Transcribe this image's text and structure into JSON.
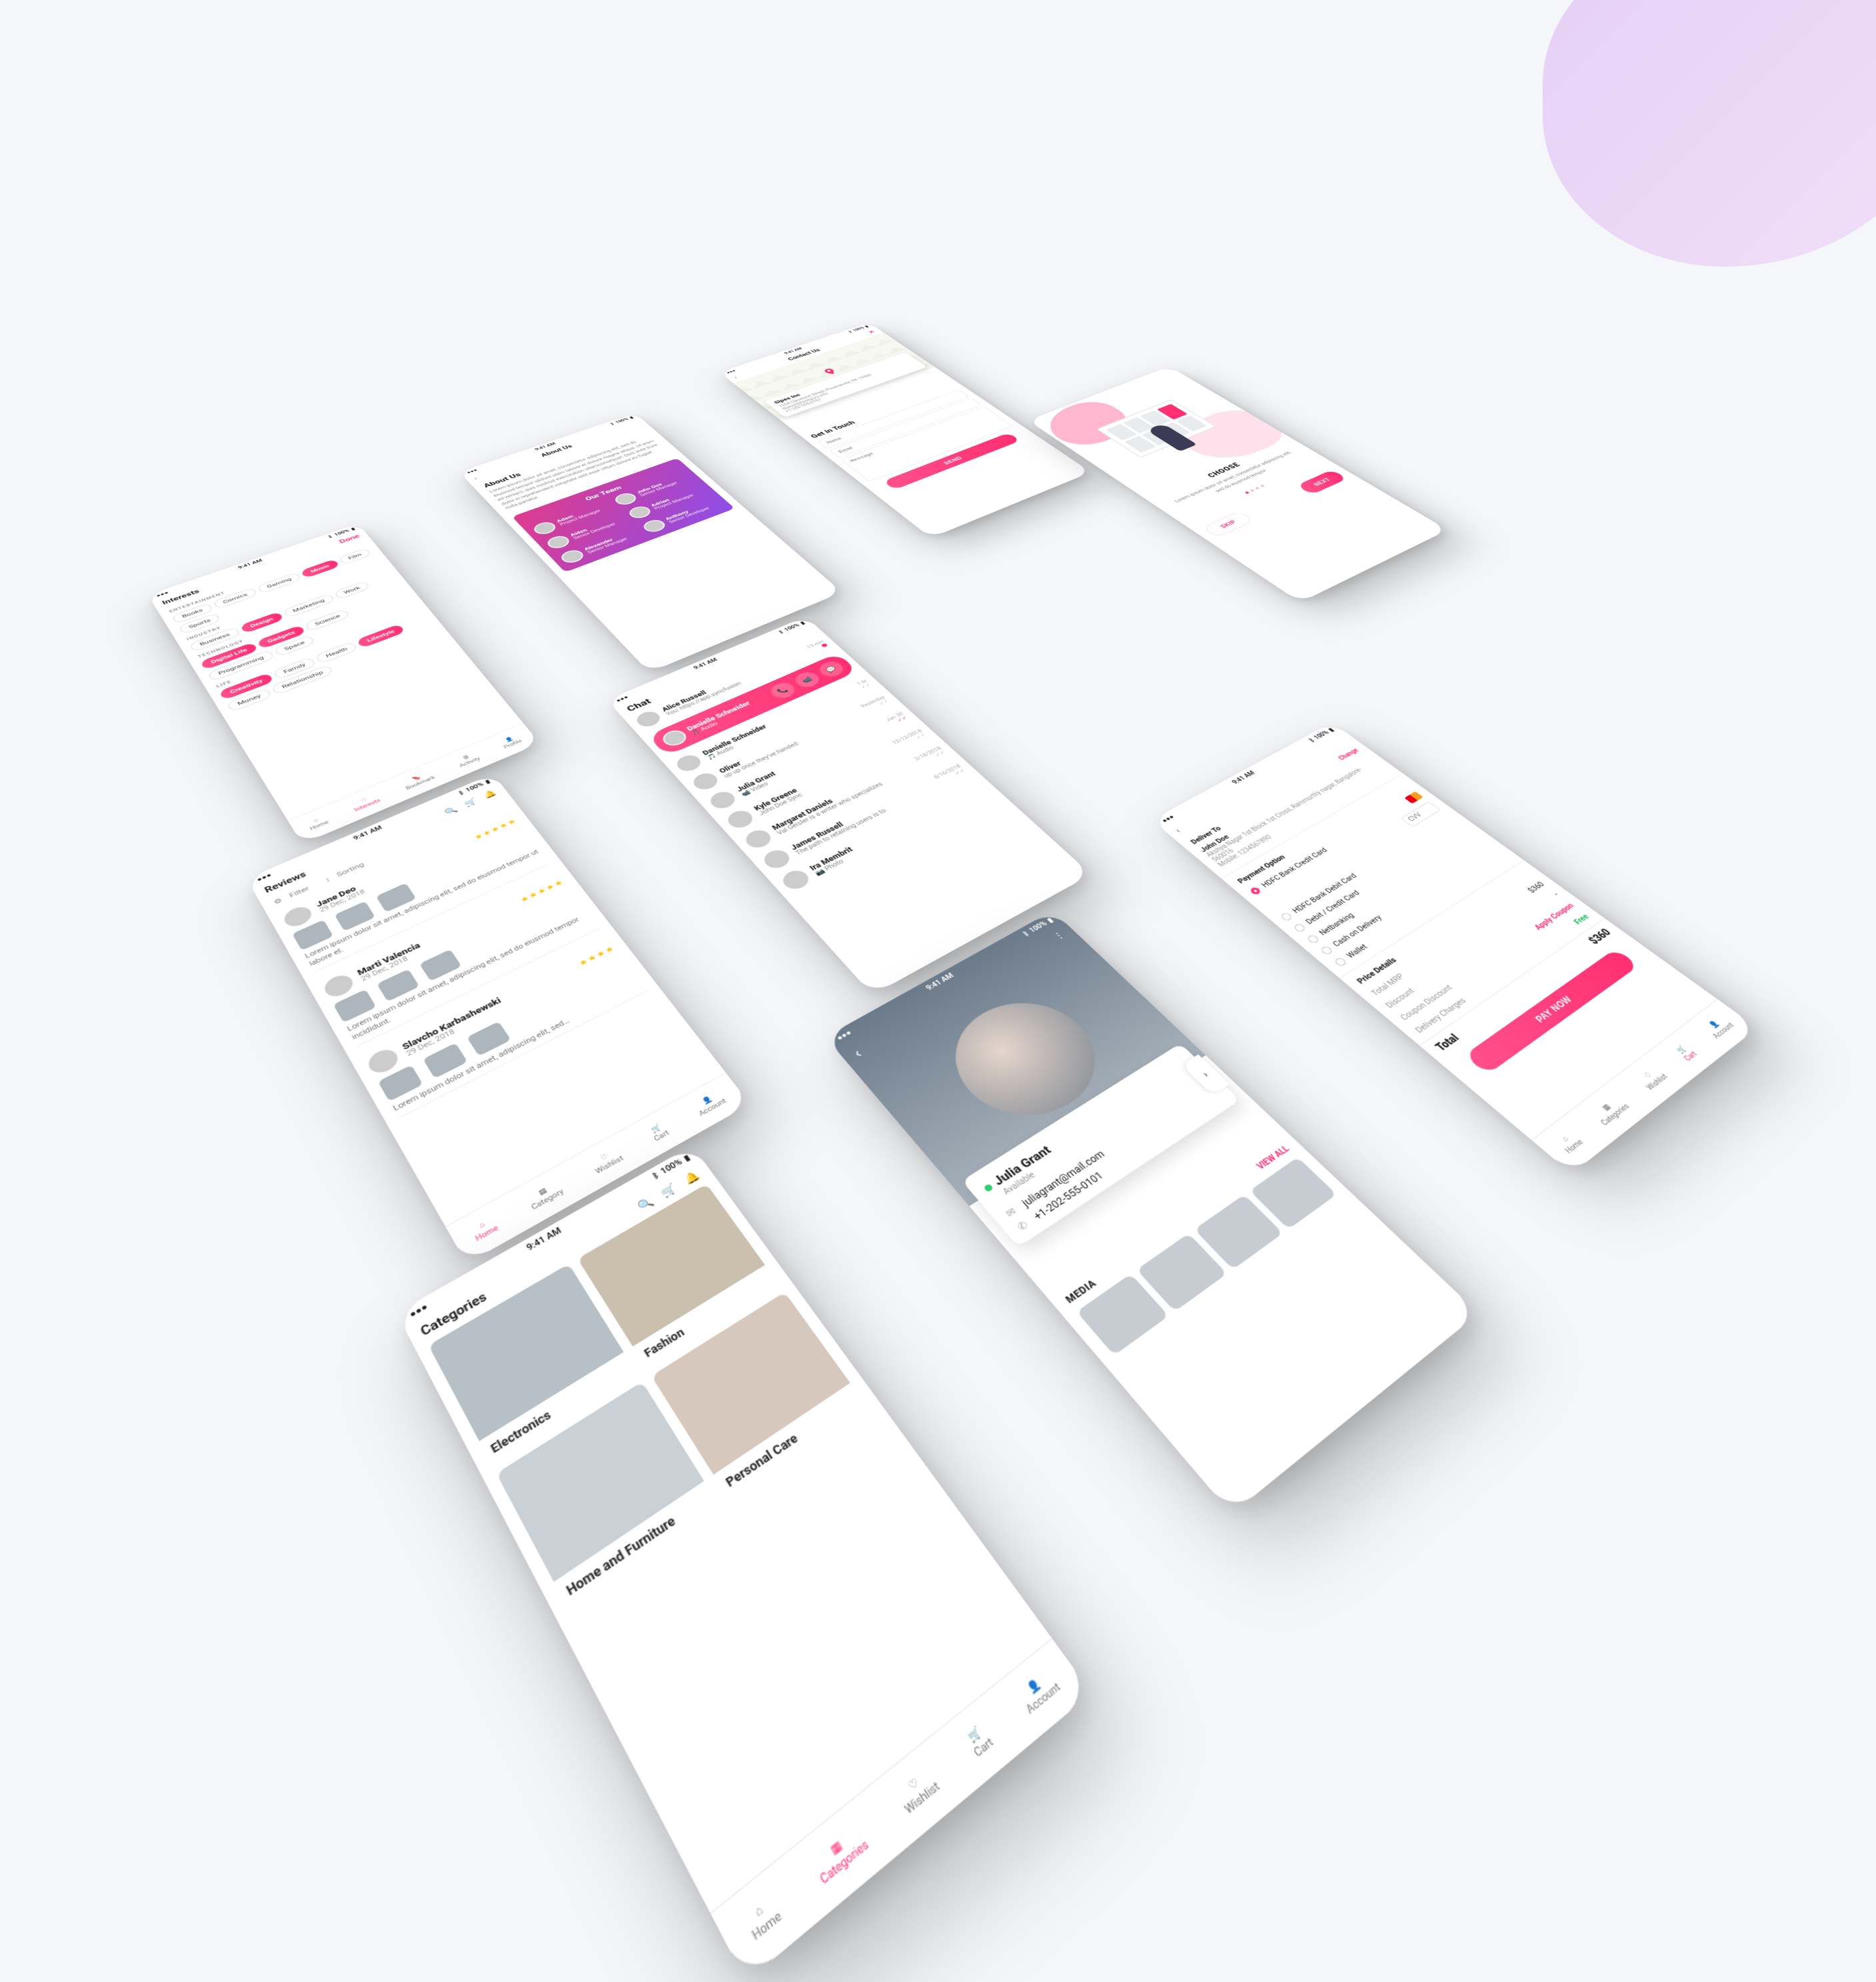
{
  "status": {
    "time": "9:41 AM",
    "battery": "100%"
  },
  "interests": {
    "title": "Interests",
    "action": "Done",
    "groups": [
      {
        "label": "ENTERTAINMENT",
        "chips": [
          {
            "t": "Books",
            "sel": false
          },
          {
            "t": "Comics",
            "sel": false
          },
          {
            "t": "Gaming",
            "sel": false
          },
          {
            "t": "Music",
            "sel": true
          },
          {
            "t": "Film",
            "sel": false
          },
          {
            "t": "Sports",
            "sel": false
          }
        ]
      },
      {
        "label": "INDUSTRY",
        "chips": [
          {
            "t": "Business",
            "sel": false
          },
          {
            "t": "Design",
            "sel": true
          },
          {
            "t": "Marketing",
            "sel": false
          },
          {
            "t": "Work",
            "sel": false
          }
        ]
      },
      {
        "label": "TECHNOLOGY",
        "chips": [
          {
            "t": "Digital Life",
            "sel": true
          },
          {
            "t": "Gadgets",
            "sel": true
          },
          {
            "t": "Science",
            "sel": false
          },
          {
            "t": "Programming",
            "sel": false
          },
          {
            "t": "Space",
            "sel": false
          }
        ]
      },
      {
        "label": "LIFE",
        "chips": [
          {
            "t": "Creativity",
            "sel": true
          },
          {
            "t": "Family",
            "sel": false
          },
          {
            "t": "Health",
            "sel": false
          },
          {
            "t": "Lifestyle",
            "sel": true
          },
          {
            "t": "Money",
            "sel": false
          },
          {
            "t": "Relationship",
            "sel": false
          }
        ]
      }
    ],
    "nav": [
      {
        "label": "Home",
        "active": false
      },
      {
        "label": "Interests",
        "active": true
      },
      {
        "label": "Bookmark",
        "active": false
      },
      {
        "label": "Activity",
        "active": false
      },
      {
        "label": "Profile",
        "active": false
      }
    ]
  },
  "about": {
    "title": "About Us",
    "heading": "About Us",
    "body": "Lorem ipsum dolor sit amet, consectetur adipiscing elit, sed do eiusmod tempor ididunt utem labore et dolore magna aliqua. Ut enim ad veniam, quis nostrud exercitation ullamconsequat. Duis aute irure dolor in reprehenderit voluptate velit esse cillum dolore eu fugiat nulla pariatur.",
    "team_title": "Our Team",
    "team": [
      {
        "name": "Adam",
        "role": "Project Manager"
      },
      {
        "name": "John Doe",
        "role": "Senior Manager"
      },
      {
        "name": "Aiden",
        "role": "Senior Developer"
      },
      {
        "name": "Adrian",
        "role": "Project Manager"
      },
      {
        "name": "Alexander",
        "role": "Senior Manager"
      },
      {
        "name": "Anthony",
        "role": "Senior Developer"
      }
    ]
  },
  "contact": {
    "title": "Contact Us",
    "card": {
      "company": "Sipes Inc",
      "address": "7654 Cleveland Street, Phoenixville, PA 19460",
      "email": "dopuyi@hostguru.info",
      "phone": "+1-202-555-0101"
    },
    "heading": "Get in Touch",
    "fields": {
      "name": "Name",
      "email": "Email",
      "message": "Message"
    },
    "submit": "SEND"
  },
  "reviews": {
    "title": "Reviews",
    "filter": "Filter",
    "sorting": "Sorting",
    "items": [
      {
        "name": "Jane Deo",
        "date": "29 Dec, 2018",
        "rating": 5,
        "text": "Lorem ipsum dolor sit amet, adipiscing elit, sed do eiusmod tempor ut labore et."
      },
      {
        "name": "Marti Valencia",
        "date": "29 Dec, 2018",
        "rating": 5,
        "text": "Lorem ipsum dolor sit amet, adipiscing elit, sed do eiusmod tempor incididunt."
      },
      {
        "name": "Slavcho Karbashewski",
        "date": "29 Dec, 2018",
        "rating": 4,
        "text": "Lorem ipsum dolor sit amet, adipiscing elit, sed…"
      }
    ],
    "nav": [
      {
        "label": "Home",
        "active": true
      },
      {
        "label": "Category",
        "active": false
      },
      {
        "label": "Wishlist",
        "active": false
      },
      {
        "label": "Cart",
        "active": false
      },
      {
        "label": "Account",
        "active": false
      }
    ]
  },
  "chat": {
    "title": "Chat",
    "threads": [
      {
        "name": "Alice Russell",
        "sub": "You: https://app.syncfusion",
        "time": "15 min",
        "status": "unread"
      },
      {
        "name": "Danielle Schneider",
        "sub": "🎵 Audio",
        "time": "1 hr",
        "status": "sent"
      },
      {
        "name": "Oliver",
        "sub": "up up once they've handed",
        "time": "Yesterday",
        "status": "read"
      },
      {
        "name": "Julia Grant",
        "sub": "📹 Video",
        "time": "Jan 30",
        "status": "sent-accent"
      },
      {
        "name": "Kyle Greene",
        "sub": "John Doe Sync",
        "time": "12/12/2018",
        "status": "read"
      },
      {
        "name": "Margaret Daniels",
        "sub": "Val Geisler is a writer who specializes",
        "time": "3/18/2018",
        "status": "read"
      },
      {
        "name": "James Russell",
        "sub": "The path to retaining users is to",
        "time": "8/16/2018",
        "status": "read"
      },
      {
        "name": "Ira Membrit",
        "sub": "📷 Photo",
        "time": "",
        "status": ""
      }
    ],
    "call": {
      "title": "Danielle Schneider",
      "sub": "🎵 Audio"
    }
  },
  "categories": {
    "title": "Categories",
    "items": [
      "Electronics",
      "Fashion",
      "Home and Furniture",
      "Personal Care"
    ],
    "nav": [
      {
        "label": "Home",
        "active": false
      },
      {
        "label": "Categories",
        "active": true
      },
      {
        "label": "Wishlist",
        "active": false
      },
      {
        "label": "Cart",
        "active": false
      },
      {
        "label": "Account",
        "active": false
      }
    ]
  },
  "profile": {
    "name": "Julia Grant",
    "status": "Available",
    "email": "juliagrant@mail.com",
    "phone": "+1-202-555-0101",
    "media_title": "MEDIA",
    "view_all": "VIEW ALL"
  },
  "checkout": {
    "deliver_to_label": "Deliver To",
    "change": "Change",
    "name": "John Doe",
    "address": "Akshya Nagar 1st Block 1st Cross, Rammurthy nagar, Bangalore-560016",
    "mobile": "Mobile: 1234567890",
    "payment_label": "Payment Option",
    "options": [
      {
        "label": "HDFC Bank Credit Card",
        "selected": true,
        "extra": "CVV"
      },
      {
        "label": "HDFC Bank Debit Card",
        "selected": false
      },
      {
        "label": "Debit / Credit Card",
        "selected": false
      },
      {
        "label": "Netbanking",
        "selected": false
      },
      {
        "label": "Cash on Delivery",
        "selected": false
      },
      {
        "label": "Wallet",
        "selected": false
      }
    ],
    "price_label": "Price Details",
    "lines": [
      {
        "k": "Total MRP",
        "v": "$360"
      },
      {
        "k": "Discount",
        "v": "-"
      },
      {
        "k": "Coupon Discount",
        "v": "Apply Coupon",
        "accent": true
      },
      {
        "k": "Delivery Charges",
        "v": "Free",
        "good": true
      }
    ],
    "total_label": "Total",
    "total_value": "$360",
    "pay": "PAY NOW",
    "nav": [
      {
        "label": "Home",
        "active": false
      },
      {
        "label": "Categories",
        "active": false
      },
      {
        "label": "Wishlist",
        "active": false
      },
      {
        "label": "Cart",
        "active": true
      },
      {
        "label": "Account",
        "active": false
      }
    ]
  },
  "onboarding": {
    "title": "CHOOSE",
    "body": "Lorem ipsum dolor sit amet, consectetur adipiscing elit, sed do eiusmod tempor",
    "skip": "SKIP",
    "next": "NEXT",
    "page_index": 0,
    "page_count": 4
  }
}
